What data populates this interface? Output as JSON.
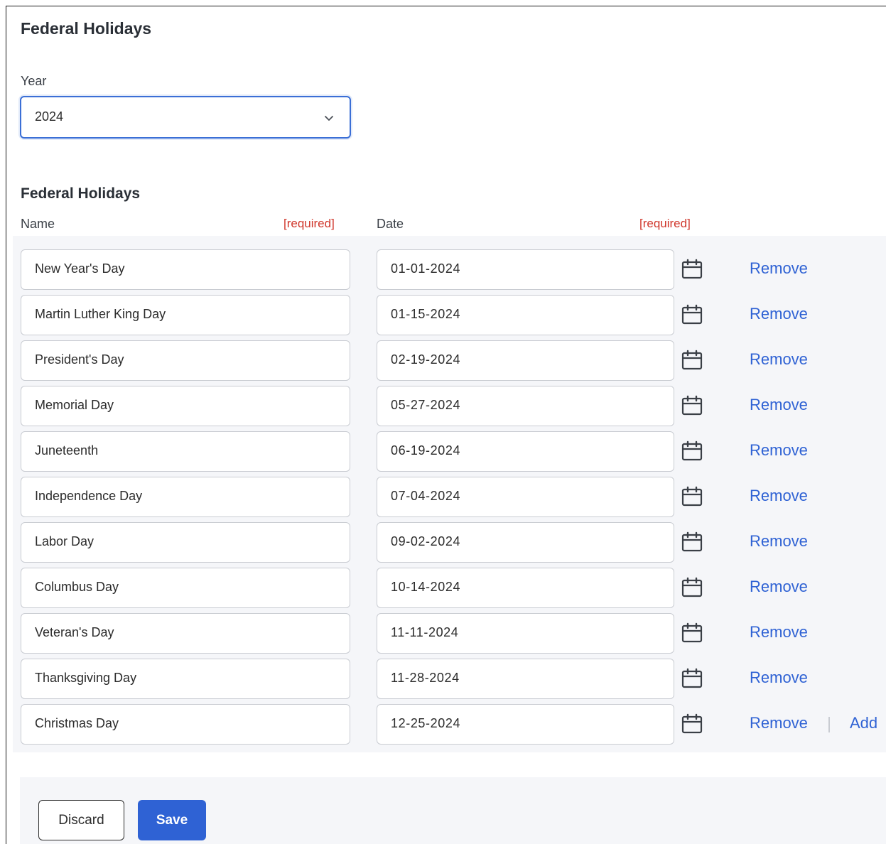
{
  "page": {
    "title": "Federal Holidays",
    "year_label": "Year",
    "year_value": "2024"
  },
  "section": {
    "title": "Federal Holidays",
    "name_header": "Name",
    "date_header": "Date",
    "required_label": "[required]"
  },
  "holidays": [
    {
      "name": "New Year's Day",
      "date": "01-01-2024"
    },
    {
      "name": "Martin Luther King Day",
      "date": "01-15-2024"
    },
    {
      "name": "President's Day",
      "date": "02-19-2024"
    },
    {
      "name": "Memorial Day",
      "date": "05-27-2024"
    },
    {
      "name": "Juneteenth",
      "date": "06-19-2024"
    },
    {
      "name": "Independence Day",
      "date": "07-04-2024"
    },
    {
      "name": "Labor Day",
      "date": "09-02-2024"
    },
    {
      "name": "Columbus Day",
      "date": "10-14-2024"
    },
    {
      "name": "Veteran's Day",
      "date": "11-11-2024"
    },
    {
      "name": "Thanksgiving Day",
      "date": "11-28-2024"
    },
    {
      "name": "Christmas Day",
      "date": "12-25-2024"
    }
  ],
  "actions": {
    "remove_label": "Remove",
    "add_label": "Add",
    "discard_label": "Discard",
    "save_label": "Save"
  },
  "icons": {
    "year_dropdown": "chevron-down-icon",
    "date_picker": "calendar-icon"
  },
  "colors": {
    "accent": "#2f62d4",
    "required": "#d0362b",
    "focus_border": "#3b6fd6",
    "row_background": "#f5f6f9"
  }
}
